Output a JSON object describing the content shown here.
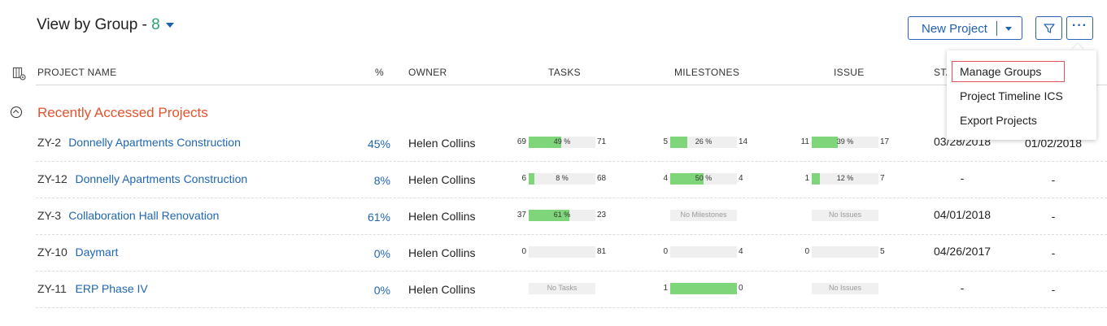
{
  "view": {
    "label": "View by Group -",
    "count": "8"
  },
  "toolbar": {
    "new_project": "New Project"
  },
  "columns": {
    "name": "PROJECT NAME",
    "percent": "%",
    "owner": "OWNER",
    "tasks": "TASKS",
    "milestones": "MILESTONES",
    "issue": "ISSUE",
    "start": "STA"
  },
  "group": {
    "title": "Recently Accessed Projects"
  },
  "rows": [
    {
      "id": "ZY-2",
      "name": "Donnelly Apartments Construction",
      "percent": "45%",
      "owner": "Helen Collins",
      "tasks": {
        "left": "69",
        "right": "71",
        "label": "49 %",
        "fill": 0.49
      },
      "milestones": {
        "left": "5",
        "right": "14",
        "label": "26 %",
        "fill": 0.26
      },
      "issues": {
        "left": "11",
        "right": "17",
        "label": "39 %",
        "fill": 0.39
      },
      "start": "03/28/2018",
      "end": "01/02/2018"
    },
    {
      "id": "ZY-12",
      "name": "Donnelly Apartments Construction",
      "percent": "8%",
      "owner": "Helen Collins",
      "tasks": {
        "left": "6",
        "right": "68",
        "label": "8 %",
        "fill": 0.08
      },
      "milestones": {
        "left": "4",
        "right": "4",
        "label": "50 %",
        "fill": 0.5
      },
      "issues": {
        "left": "1",
        "right": "7",
        "label": "12 %",
        "fill": 0.12
      },
      "start": "-",
      "end": "-"
    },
    {
      "id": "ZY-3",
      "name": "Collaboration Hall Renovation",
      "percent": "61%",
      "owner": "Helen Collins",
      "tasks": {
        "left": "37",
        "right": "23",
        "label": "61 %",
        "fill": 0.61
      },
      "milestones": {
        "empty": "No Milestones"
      },
      "issues": {
        "empty": "No Issues"
      },
      "start": "04/01/2018",
      "end": "-"
    },
    {
      "id": "ZY-10",
      "name": "Daymart",
      "percent": "0%",
      "owner": "Helen Collins",
      "tasks": {
        "left": "0",
        "right": "81",
        "label": "",
        "fill": 0
      },
      "milestones": {
        "left": "0",
        "right": "4",
        "label": "",
        "fill": 0
      },
      "issues": {
        "left": "0",
        "right": "5",
        "label": "",
        "fill": 0
      },
      "start": "04/26/2017",
      "end": "-"
    },
    {
      "id": "ZY-11",
      "name": "ERP Phase IV",
      "percent": "0%",
      "owner": "Helen Collins",
      "tasks": {
        "empty": "No Tasks"
      },
      "milestones": {
        "left": "1",
        "right": "0",
        "label": "",
        "fill": 1.0
      },
      "issues": {
        "empty": "No Issues"
      },
      "start": "-",
      "end": "-"
    }
  ],
  "menu": {
    "items": [
      "Manage Groups",
      "Project Timeline ICS",
      "Export Projects"
    ]
  },
  "colors": {
    "accent": "#1f66b6",
    "group_title": "#e4532b",
    "count": "#27a36d",
    "progress": "#7ed57a"
  }
}
